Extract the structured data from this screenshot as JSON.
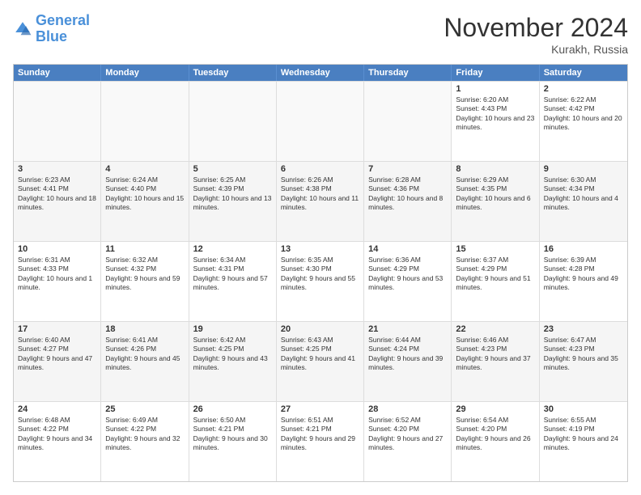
{
  "logo": {
    "line1": "General",
    "line2": "Blue"
  },
  "title": "November 2024",
  "location": "Kurakh, Russia",
  "headers": [
    "Sunday",
    "Monday",
    "Tuesday",
    "Wednesday",
    "Thursday",
    "Friday",
    "Saturday"
  ],
  "rows": [
    [
      {
        "day": "",
        "info": ""
      },
      {
        "day": "",
        "info": ""
      },
      {
        "day": "",
        "info": ""
      },
      {
        "day": "",
        "info": ""
      },
      {
        "day": "",
        "info": ""
      },
      {
        "day": "1",
        "info": "Sunrise: 6:20 AM\nSunset: 4:43 PM\nDaylight: 10 hours and 23 minutes."
      },
      {
        "day": "2",
        "info": "Sunrise: 6:22 AM\nSunset: 4:42 PM\nDaylight: 10 hours and 20 minutes."
      }
    ],
    [
      {
        "day": "3",
        "info": "Sunrise: 6:23 AM\nSunset: 4:41 PM\nDaylight: 10 hours and 18 minutes."
      },
      {
        "day": "4",
        "info": "Sunrise: 6:24 AM\nSunset: 4:40 PM\nDaylight: 10 hours and 15 minutes."
      },
      {
        "day": "5",
        "info": "Sunrise: 6:25 AM\nSunset: 4:39 PM\nDaylight: 10 hours and 13 minutes."
      },
      {
        "day": "6",
        "info": "Sunrise: 6:26 AM\nSunset: 4:38 PM\nDaylight: 10 hours and 11 minutes."
      },
      {
        "day": "7",
        "info": "Sunrise: 6:28 AM\nSunset: 4:36 PM\nDaylight: 10 hours and 8 minutes."
      },
      {
        "day": "8",
        "info": "Sunrise: 6:29 AM\nSunset: 4:35 PM\nDaylight: 10 hours and 6 minutes."
      },
      {
        "day": "9",
        "info": "Sunrise: 6:30 AM\nSunset: 4:34 PM\nDaylight: 10 hours and 4 minutes."
      }
    ],
    [
      {
        "day": "10",
        "info": "Sunrise: 6:31 AM\nSunset: 4:33 PM\nDaylight: 10 hours and 1 minute."
      },
      {
        "day": "11",
        "info": "Sunrise: 6:32 AM\nSunset: 4:32 PM\nDaylight: 9 hours and 59 minutes."
      },
      {
        "day": "12",
        "info": "Sunrise: 6:34 AM\nSunset: 4:31 PM\nDaylight: 9 hours and 57 minutes."
      },
      {
        "day": "13",
        "info": "Sunrise: 6:35 AM\nSunset: 4:30 PM\nDaylight: 9 hours and 55 minutes."
      },
      {
        "day": "14",
        "info": "Sunrise: 6:36 AM\nSunset: 4:29 PM\nDaylight: 9 hours and 53 minutes."
      },
      {
        "day": "15",
        "info": "Sunrise: 6:37 AM\nSunset: 4:29 PM\nDaylight: 9 hours and 51 minutes."
      },
      {
        "day": "16",
        "info": "Sunrise: 6:39 AM\nSunset: 4:28 PM\nDaylight: 9 hours and 49 minutes."
      }
    ],
    [
      {
        "day": "17",
        "info": "Sunrise: 6:40 AM\nSunset: 4:27 PM\nDaylight: 9 hours and 47 minutes."
      },
      {
        "day": "18",
        "info": "Sunrise: 6:41 AM\nSunset: 4:26 PM\nDaylight: 9 hours and 45 minutes."
      },
      {
        "day": "19",
        "info": "Sunrise: 6:42 AM\nSunset: 4:25 PM\nDaylight: 9 hours and 43 minutes."
      },
      {
        "day": "20",
        "info": "Sunrise: 6:43 AM\nSunset: 4:25 PM\nDaylight: 9 hours and 41 minutes."
      },
      {
        "day": "21",
        "info": "Sunrise: 6:44 AM\nSunset: 4:24 PM\nDaylight: 9 hours and 39 minutes."
      },
      {
        "day": "22",
        "info": "Sunrise: 6:46 AM\nSunset: 4:23 PM\nDaylight: 9 hours and 37 minutes."
      },
      {
        "day": "23",
        "info": "Sunrise: 6:47 AM\nSunset: 4:23 PM\nDaylight: 9 hours and 35 minutes."
      }
    ],
    [
      {
        "day": "24",
        "info": "Sunrise: 6:48 AM\nSunset: 4:22 PM\nDaylight: 9 hours and 34 minutes."
      },
      {
        "day": "25",
        "info": "Sunrise: 6:49 AM\nSunset: 4:22 PM\nDaylight: 9 hours and 32 minutes."
      },
      {
        "day": "26",
        "info": "Sunrise: 6:50 AM\nSunset: 4:21 PM\nDaylight: 9 hours and 30 minutes."
      },
      {
        "day": "27",
        "info": "Sunrise: 6:51 AM\nSunset: 4:21 PM\nDaylight: 9 hours and 29 minutes."
      },
      {
        "day": "28",
        "info": "Sunrise: 6:52 AM\nSunset: 4:20 PM\nDaylight: 9 hours and 27 minutes."
      },
      {
        "day": "29",
        "info": "Sunrise: 6:54 AM\nSunset: 4:20 PM\nDaylight: 9 hours and 26 minutes."
      },
      {
        "day": "30",
        "info": "Sunrise: 6:55 AM\nSunset: 4:19 PM\nDaylight: 9 hours and 24 minutes."
      }
    ]
  ]
}
